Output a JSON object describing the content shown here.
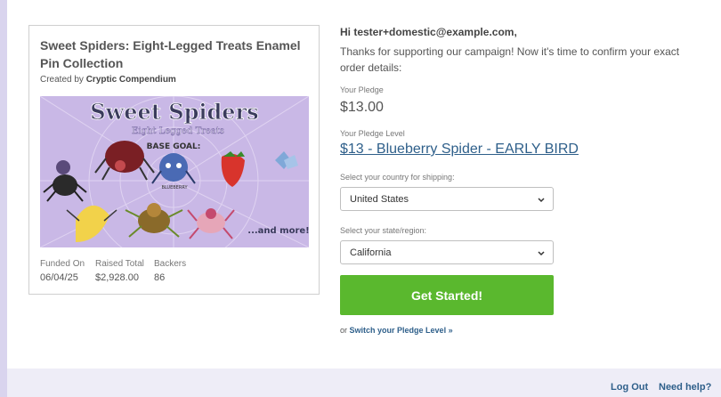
{
  "campaign": {
    "title": "Sweet Spiders: Eight-Legged Treats Enamel Pin Collection",
    "created_by_prefix": "Created by",
    "creator": "Cryptic Compendium",
    "image": {
      "headline": "Sweet Spiders",
      "subheadline": "Eight Legged Treats",
      "base_goal": "BASE GOAL:",
      "more": "...and more!",
      "blueberry_tag": "BLUEBERRY"
    },
    "stats": [
      {
        "label": "Funded On",
        "value": "06/04/25"
      },
      {
        "label": "Raised Total",
        "value": "$2,928.00"
      },
      {
        "label": "Backers",
        "value": "86"
      }
    ]
  },
  "order": {
    "greeting": "Hi tester+domestic@example.com,",
    "intro": "Thanks for supporting our campaign! Now it's time to confirm your exact order details:",
    "pledge_label": "Your Pledge",
    "pledge_amount": "$13.00",
    "pledge_level_label": "Your Pledge Level",
    "pledge_level": "$13 - Blueberry Spider - EARLY BIRD",
    "country_label": "Select your country for shipping:",
    "country_value": "United States",
    "state_label": "Select your state/region:",
    "state_value": "California",
    "cta": "Get Started!",
    "switch_prefix": "or",
    "switch_link": "Switch your Pledge Level »"
  },
  "footer": {
    "logout": "Log Out",
    "help": "Need help?"
  },
  "colors": {
    "accent_green": "#5ab82e",
    "link_blue": "#2e5f8a",
    "page_bg": "#d9d4ee"
  },
  "icons": [
    "chevron-down-icon"
  ]
}
